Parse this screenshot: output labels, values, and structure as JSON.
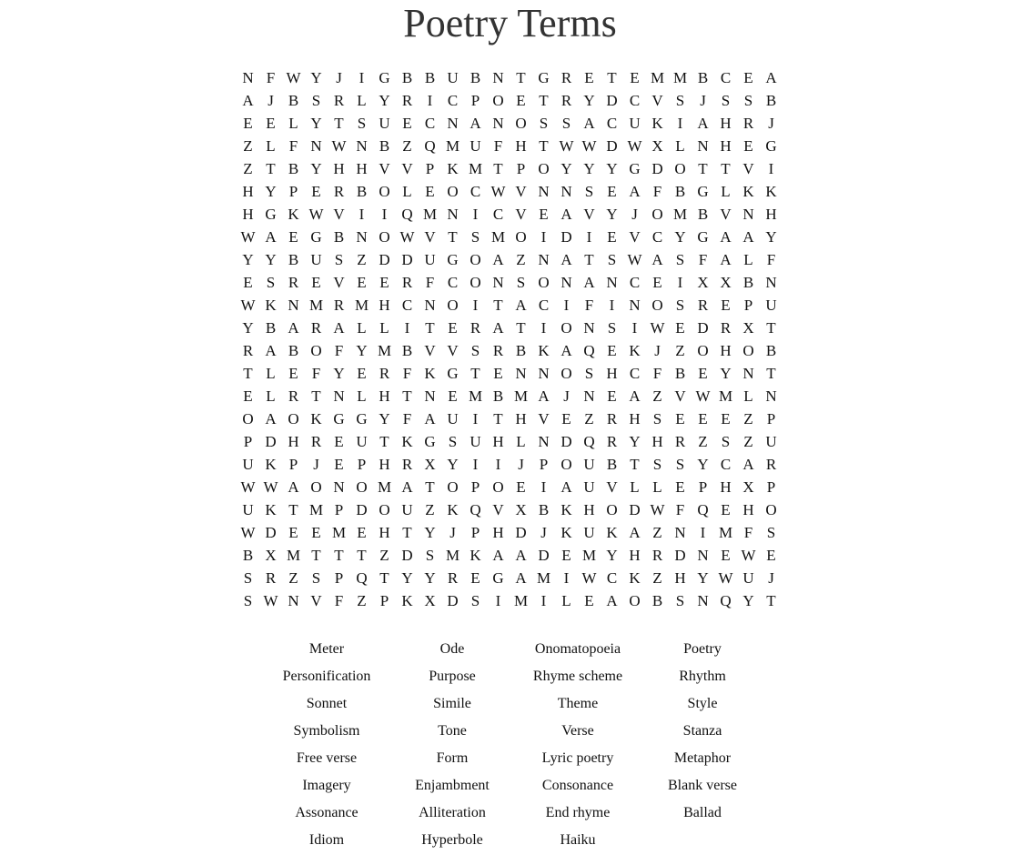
{
  "title": "Poetry Terms",
  "grid": [
    "NFWYJIGBBUBNTGRETEMMBCEA",
    "AJBSRLYRICPOETRYDCVSJSSB",
    "EELYTSUECNANOSSACUKIAHRJ",
    "ZLFNWNBZQMUFHTWWDWXLNHEG",
    "ZTBYHHVVPKMTPOYYYGDOTTVI",
    "HYPERBOLEOCWVNNSEAFBGLKK",
    "HGKWVIIQMNICVEAVYJOMBVNH",
    "WAEGBNOWVTSMOIDIEVCYGAAY",
    "YYBUSZDDUGOAZNATSWASFALF",
    "ESREVEERFCONSONANCEIXXBN",
    "WKNMRMHCNOITACIFINOSREPU",
    "YBARALLITERATIONSIWEDRXT",
    "RABOFYMBVVSRBKAQEKJZOHOB",
    "TLEFYERFKGTENNOSHCFBEYNT",
    "ELRTNLHTNEMBMAJNEAZVWMLN",
    "OAOKGGYFAUITHVEZRHSEEEZP",
    "PDHREUTKGSUHLNDQRYHRZSZU",
    "UKPJEPHRXYIIJPOUBTSSYCAR",
    "WWAONOMATOPOEIAUVLLEPHXP",
    "UKTMPDOUZKQVXBKHODWFQEHO",
    "WDEEMEHTYJPHDJKUKAZNIMFS",
    "BXMTTTZDSMKAADEMYHRDNEWE",
    "SRZSPQTYYREGAMIWCKZHYWUJ",
    "SWNVFZPKXDSIMILEAOBSNQYT"
  ],
  "words": [
    "Meter",
    "Ode",
    "Onomatopoeia",
    "Poetry",
    "Personification",
    "Purpose",
    "Rhyme scheme",
    "Rhythm",
    "Sonnet",
    "Simile",
    "Theme",
    "Style",
    "Symbolism",
    "Tone",
    "Verse",
    "Stanza",
    "Free verse",
    "Form",
    "Lyric poetry",
    "Metaphor",
    "Imagery",
    "Enjambment",
    "Consonance",
    "Blank verse",
    "Assonance",
    "Alliteration",
    "End rhyme",
    "Ballad",
    "Idiom",
    "Hyperbole",
    "Haiku"
  ]
}
